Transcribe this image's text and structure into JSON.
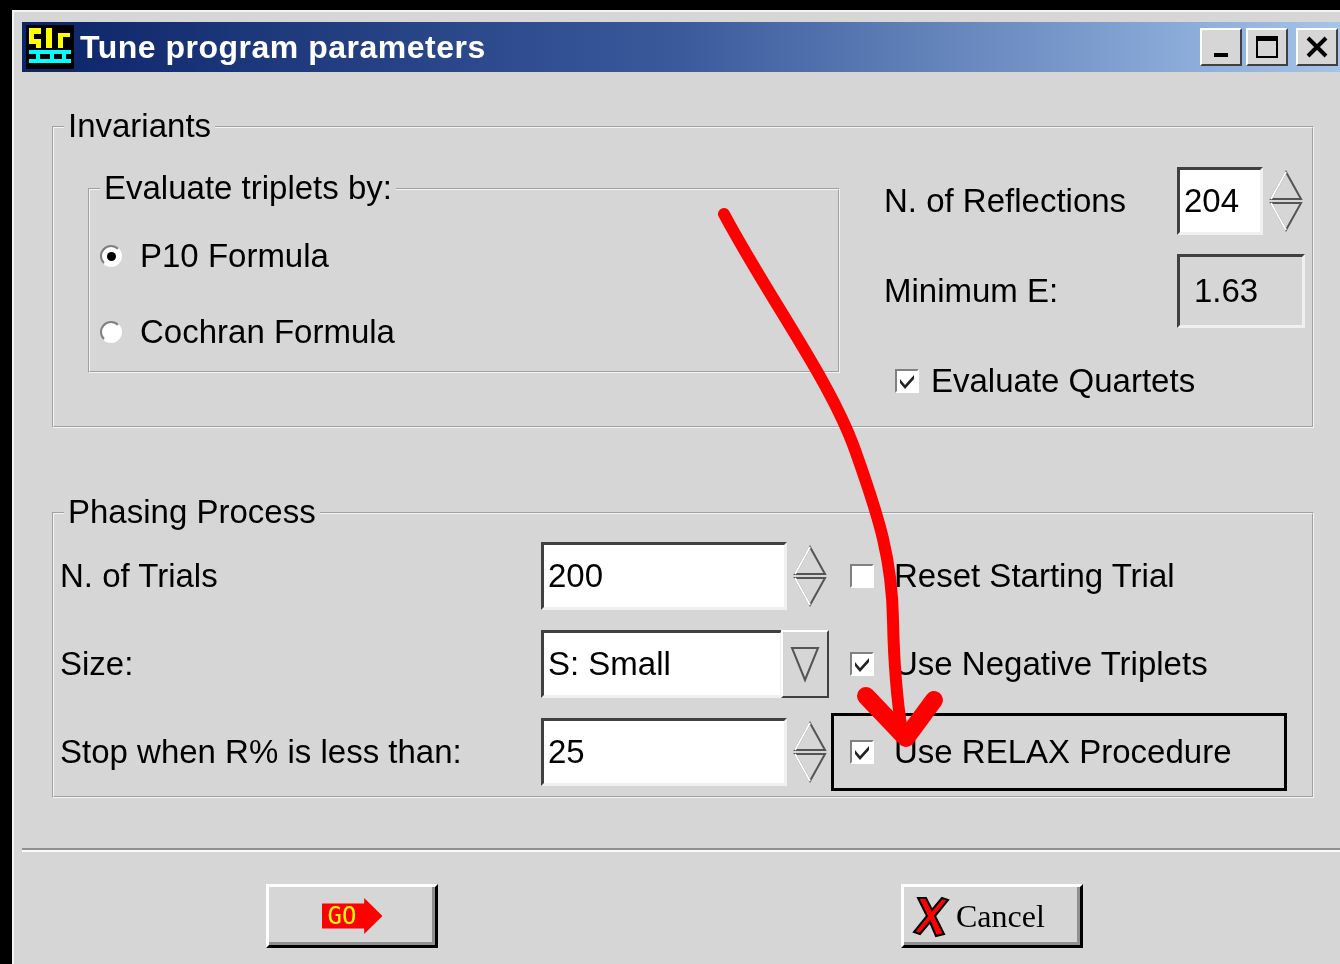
{
  "window": {
    "title": "Tune program parameters"
  },
  "invariants": {
    "title": "Invariants",
    "triplets": {
      "title": "Evaluate triplets by:",
      "options": [
        {
          "label": "P10 Formula",
          "selected": true
        },
        {
          "label": "Cochran Formula",
          "selected": false
        }
      ]
    },
    "reflections": {
      "label": "N. of Reflections",
      "value": "204"
    },
    "minimum_e": {
      "label": "Minimum E:",
      "value": "1.63",
      "disabled": true
    },
    "quartets": {
      "label": "Evaluate Quartets",
      "checked": true
    }
  },
  "phasing": {
    "title": "Phasing Process",
    "rows": [
      {
        "label": "N. of Trials",
        "value": "200",
        "kind": "spin",
        "option": {
          "label": "Reset Starting Trial",
          "checked": false,
          "focused": false
        }
      },
      {
        "label": "Size:",
        "value": "S: Small",
        "kind": "dropdown",
        "option": {
          "label": "Use Negative Triplets",
          "checked": true,
          "focused": false
        }
      },
      {
        "label": "Stop when R% is less than:",
        "value": "25",
        "kind": "spin",
        "option": {
          "label": "Use RELAX Procedure",
          "checked": true,
          "focused": true
        }
      }
    ]
  },
  "buttons": [
    {
      "kind": "go",
      "label": "GO"
    },
    {
      "kind": "cancel",
      "label": "Cancel"
    }
  ]
}
